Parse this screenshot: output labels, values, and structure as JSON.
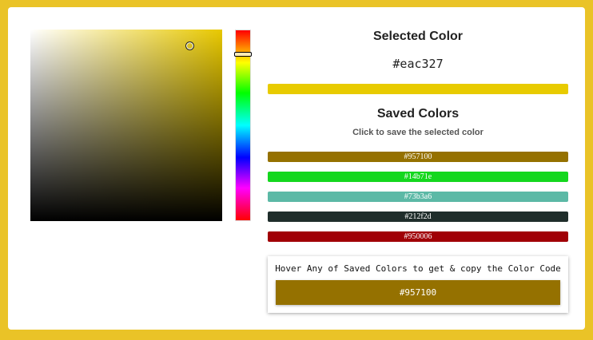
{
  "picker": {
    "base_hue_color": "#e8c800",
    "marker": "sv-cursor"
  },
  "selected": {
    "title": "Selected Color",
    "hex": "#eac327",
    "swatch_color": "#e8cb00"
  },
  "saved": {
    "title": "Saved Colors",
    "subtitle": "Click to save the selected color",
    "items": [
      {
        "label": "#957100",
        "color": "#957100"
      },
      {
        "label": "#14b71e",
        "color": "#14d71e"
      },
      {
        "label": "#73b3a6",
        "color": "#5cb9a6"
      },
      {
        "label": "#212f2d",
        "color": "#1f2d2b"
      },
      {
        "label": "#950006",
        "color": "#a00006"
      }
    ]
  },
  "hover": {
    "text": "Hover Any of Saved Colors to get & copy the Color Code",
    "chip_label": "#957100",
    "chip_color": "#957100"
  }
}
